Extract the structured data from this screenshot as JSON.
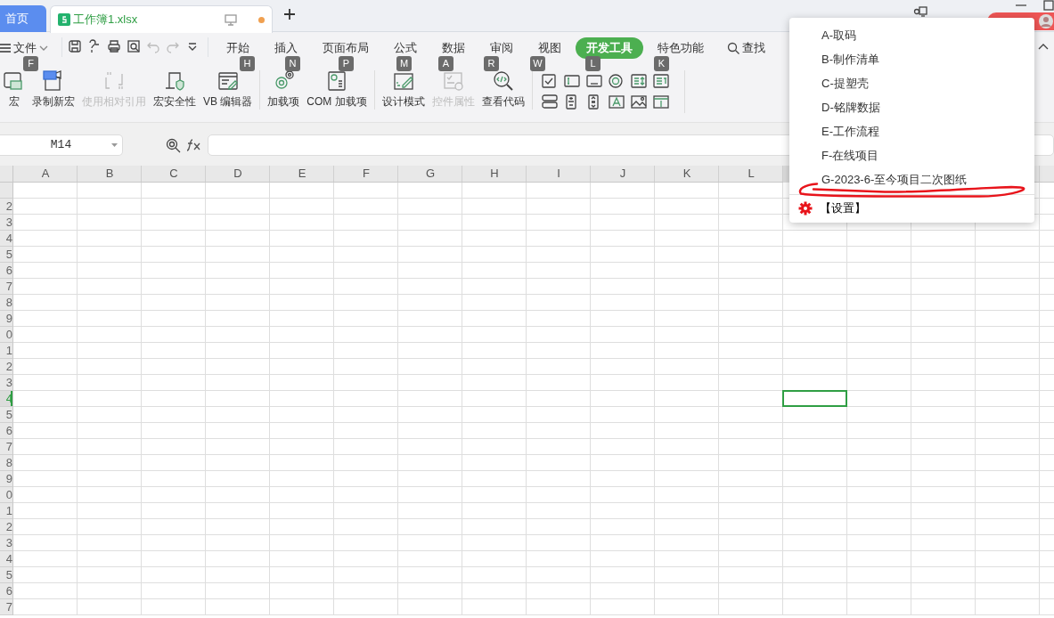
{
  "tabs": [
    {
      "label": "首页",
      "kind": "home",
      "selected": false
    },
    {
      "label": "工作簿1.xlsx",
      "kind": "document",
      "selected": true,
      "unsaved": true
    }
  ],
  "file_menu": {
    "label": "文件"
  },
  "menu_tabs": [
    {
      "label": "开始",
      "selected": false
    },
    {
      "label": "插入",
      "selected": false
    },
    {
      "label": "页面布局",
      "selected": false
    },
    {
      "label": "公式",
      "selected": false
    },
    {
      "label": "数据",
      "selected": false
    },
    {
      "label": "审阅",
      "selected": false
    },
    {
      "label": "视图",
      "selected": false
    },
    {
      "label": "开发工具",
      "selected": true
    },
    {
      "label": "特色功能",
      "selected": false
    }
  ],
  "search": {
    "label": "查找"
  },
  "key_tips": [
    {
      "label": "F"
    },
    {
      "label": "H"
    },
    {
      "label": "N"
    },
    {
      "label": "P"
    },
    {
      "label": "M"
    },
    {
      "label": "A"
    },
    {
      "label": "R"
    },
    {
      "label": "W"
    },
    {
      "label": "L"
    },
    {
      "label": "K"
    }
  ],
  "ribbon_groups": [
    [
      {
        "label": "宏",
        "disabled": false
      },
      {
        "label": "录制新宏",
        "disabled": false
      },
      {
        "label": "使用相对引用",
        "disabled": true
      },
      {
        "label": "宏安全性",
        "disabled": false
      },
      {
        "label": "VB 编辑器",
        "disabled": false
      }
    ],
    [
      {
        "label": "加载项",
        "disabled": false
      },
      {
        "label": "COM 加载项",
        "disabled": false
      }
    ],
    [
      {
        "label": "设计模式",
        "disabled": false
      },
      {
        "label": "控件属性",
        "disabled": true
      },
      {
        "label": "查看代码",
        "disabled": false
      }
    ]
  ],
  "formula_bar": {
    "name_box": "M14"
  },
  "sheet": {
    "columns": [
      {
        "label": "A",
        "selected": false
      },
      {
        "label": "B",
        "selected": false
      },
      {
        "label": "C",
        "selected": false
      },
      {
        "label": "D",
        "selected": false
      },
      {
        "label": "E",
        "selected": false
      },
      {
        "label": "F",
        "selected": false
      },
      {
        "label": "G",
        "selected": false
      },
      {
        "label": "H",
        "selected": false
      },
      {
        "label": "I",
        "selected": false
      },
      {
        "label": "J",
        "selected": false
      },
      {
        "label": "K",
        "selected": false
      },
      {
        "label": "L",
        "selected": false
      },
      {
        "selected": true
      }
    ],
    "rows": [
      {
        "selected": false
      },
      {
        "label": "2",
        "selected": false
      },
      {
        "label": "3",
        "selected": false
      },
      {
        "label": "4",
        "selected": false
      },
      {
        "label": "5",
        "selected": false
      },
      {
        "label": "6",
        "selected": false
      },
      {
        "label": "7",
        "selected": false
      },
      {
        "label": "8",
        "selected": false
      },
      {
        "label": "9",
        "selected": false
      },
      {
        "label": "0",
        "selected": false
      },
      {
        "label": "1",
        "selected": false
      },
      {
        "label": "2",
        "selected": false
      },
      {
        "label": "3",
        "selected": false
      },
      {
        "label": "4",
        "selected": true
      },
      {
        "label": "5",
        "selected": false
      },
      {
        "label": "6",
        "selected": false
      },
      {
        "label": "7",
        "selected": false
      },
      {
        "label": "8",
        "selected": false
      },
      {
        "label": "9",
        "selected": false
      },
      {
        "label": "0",
        "selected": false
      },
      {
        "label": "1",
        "selected": false
      },
      {
        "label": "2",
        "selected": false
      },
      {
        "label": "3",
        "selected": false
      },
      {
        "label": "4",
        "selected": false
      },
      {
        "label": "5",
        "selected": false
      },
      {
        "label": "6",
        "selected": false
      },
      {
        "label": "7",
        "selected": false
      }
    ]
  },
  "context_menu": {
    "items": [
      {
        "label": "A-取码"
      },
      {
        "label": "B-制作清单"
      },
      {
        "label": "C-提塑壳"
      },
      {
        "label": "D-铭牌数据"
      },
      {
        "label": "E-工作流程"
      },
      {
        "label": "F-在线项目"
      },
      {
        "label": "G-2023-6-至今项目二次图纸"
      }
    ],
    "footer_item": {
      "label": "【设置】"
    }
  }
}
